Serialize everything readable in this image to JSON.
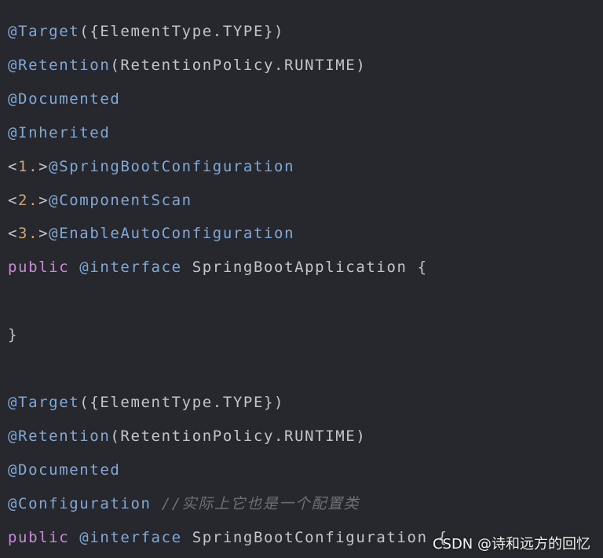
{
  "code_lines": [
    {
      "tokens": [
        {
          "t": "@Target",
          "c": "annot"
        },
        {
          "t": "({ElementType.TYPE})",
          "c": "plain"
        }
      ]
    },
    {
      "tokens": [
        {
          "t": "@Retention",
          "c": "annot"
        },
        {
          "t": "(RetentionPolicy.RUNTIME)",
          "c": "plain"
        }
      ]
    },
    {
      "tokens": [
        {
          "t": "@Documented",
          "c": "annot"
        }
      ]
    },
    {
      "tokens": [
        {
          "t": "@Inherited",
          "c": "annot"
        }
      ]
    },
    {
      "tokens": [
        {
          "t": "<",
          "c": "plain"
        },
        {
          "t": "1.",
          "c": "num"
        },
        {
          "t": ">",
          "c": "plain"
        },
        {
          "t": "@SpringBootConfiguration",
          "c": "annot"
        }
      ]
    },
    {
      "tokens": [
        {
          "t": "<",
          "c": "plain"
        },
        {
          "t": "2.",
          "c": "num"
        },
        {
          "t": ">",
          "c": "plain"
        },
        {
          "t": "@ComponentScan",
          "c": "annot"
        }
      ]
    },
    {
      "tokens": [
        {
          "t": "<",
          "c": "plain"
        },
        {
          "t": "3.",
          "c": "num"
        },
        {
          "t": ">",
          "c": "plain"
        },
        {
          "t": "@EnableAutoConfiguration",
          "c": "annot"
        }
      ]
    },
    {
      "tokens": [
        {
          "t": "public ",
          "c": "kw"
        },
        {
          "t": "@interface ",
          "c": "annot"
        },
        {
          "t": "SpringBootApplication {",
          "c": "plain"
        }
      ]
    },
    {
      "tokens": []
    },
    {
      "tokens": [
        {
          "t": "}",
          "c": "plain"
        }
      ]
    },
    {
      "tokens": []
    },
    {
      "tokens": [
        {
          "t": "@Target",
          "c": "annot"
        },
        {
          "t": "({ElementType.TYPE})",
          "c": "plain"
        }
      ]
    },
    {
      "tokens": [
        {
          "t": "@Retention",
          "c": "annot"
        },
        {
          "t": "(RetentionPolicy.RUNTIME)",
          "c": "plain"
        }
      ]
    },
    {
      "tokens": [
        {
          "t": "@Documented",
          "c": "annot"
        }
      ]
    },
    {
      "tokens": [
        {
          "t": "@Configuration ",
          "c": "annot"
        },
        {
          "t": "//实际上它也是一个配置类",
          "c": "comment"
        }
      ]
    },
    {
      "tokens": [
        {
          "t": "public ",
          "c": "kw"
        },
        {
          "t": "@interface ",
          "c": "annot"
        },
        {
          "t": "SpringBootConfiguration {",
          "c": "plain"
        }
      ]
    }
  ],
  "watermark": "CSDN @诗和远方的回忆",
  "colors": {
    "background": "#26282d",
    "annotation": "#82a9d6",
    "plain": "#c2c6cc",
    "number": "#d3a36e",
    "keyword": "#c98bd8",
    "comment": "#6c7179"
  }
}
